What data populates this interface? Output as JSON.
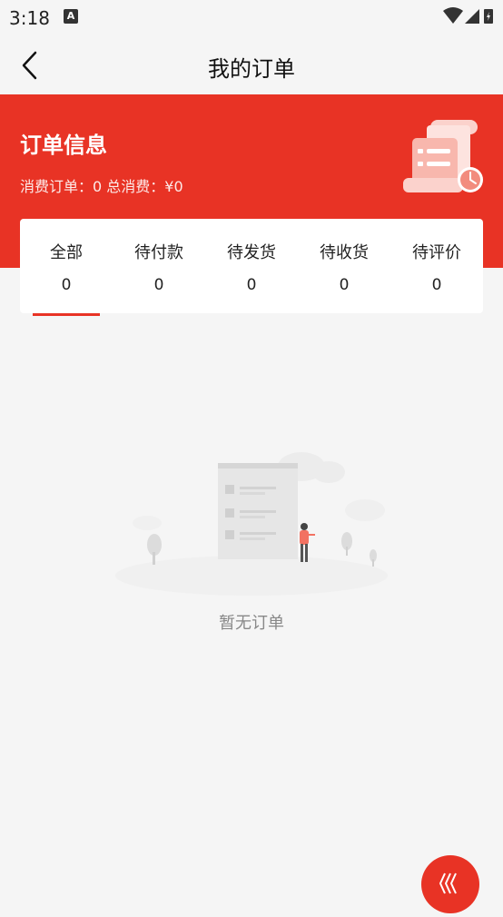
{
  "status_bar": {
    "time": "3:18",
    "notification_letter": "A"
  },
  "nav": {
    "title": "我的订单",
    "back_icon": "chevron-left-icon"
  },
  "order_info": {
    "title": "订单信息",
    "stats": "消费订单：0 总消费：¥0"
  },
  "tabs": [
    {
      "label": "全部",
      "count": "0",
      "active": true
    },
    {
      "label": "待付款",
      "count": "0",
      "active": false
    },
    {
      "label": "待发货",
      "count": "0",
      "active": false
    },
    {
      "label": "待收货",
      "count": "0",
      "active": false
    },
    {
      "label": "待评价",
      "count": "0",
      "active": false
    }
  ],
  "empty_state": {
    "text": "暂无订单"
  },
  "colors": {
    "primary": "#e83325",
    "background": "#f5f5f5"
  }
}
